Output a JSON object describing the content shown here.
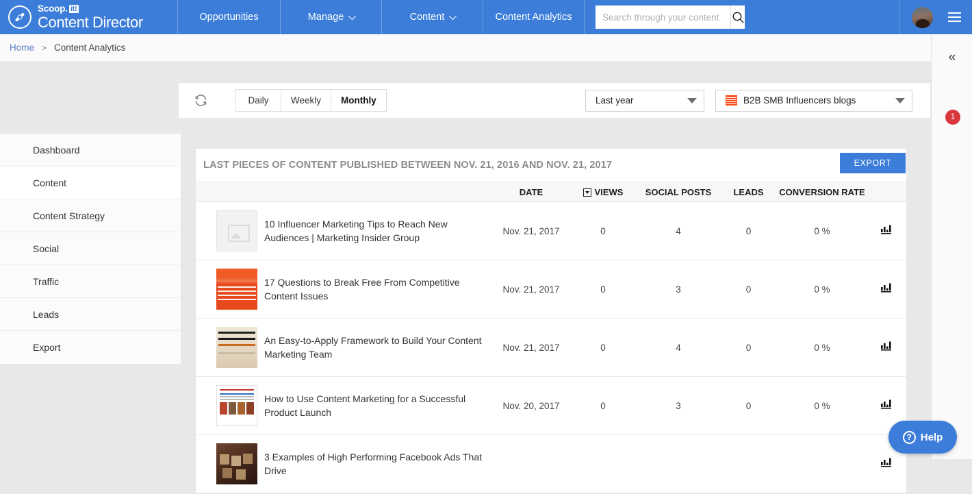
{
  "brand": {
    "top": "Scoop.",
    "badge": "it!",
    "bottom": "Content Director"
  },
  "nav": {
    "items": [
      {
        "label": "Opportunities",
        "caret": false
      },
      {
        "label": "Manage",
        "caret": true
      },
      {
        "label": "Content",
        "caret": true
      },
      {
        "label": "Content Analytics",
        "caret": false
      }
    ],
    "search": {
      "value": "",
      "placeholder": "Search through your content"
    },
    "search_icon": "search-icon",
    "avatar": "user-avatar",
    "menu_icon": "hamburger-menu-icon"
  },
  "breadcrumb": {
    "home": "Home",
    "separator": ">",
    "current": "Content Analytics"
  },
  "right_rail": {
    "collapse_icon": "«",
    "badge_count": "1"
  },
  "controls": {
    "refresh_icon": "refresh-icon",
    "periods": [
      {
        "label": "Daily",
        "active": false
      },
      {
        "label": "Weekly",
        "active": false
      },
      {
        "label": "Monthly",
        "active": true
      }
    ],
    "range_dropdown": {
      "value": "Last year"
    },
    "blog_dropdown": {
      "value": "B2B SMB Influencers blogs",
      "icon": "blog-thumbnail-icon"
    }
  },
  "sidebar": {
    "items": [
      {
        "label": "Dashboard",
        "active": false
      },
      {
        "label": "Content",
        "active": true
      },
      {
        "label": "Content Strategy",
        "active": false
      },
      {
        "label": "Social",
        "active": false
      },
      {
        "label": "Traffic",
        "active": false
      },
      {
        "label": "Leads",
        "active": false
      },
      {
        "label": "Export",
        "active": false
      }
    ]
  },
  "panel": {
    "title": "LAST PIECES OF CONTENT PUBLISHED BETWEEN NOV. 21, 2016 AND NOV. 21, 2017",
    "export_label": "EXPORT",
    "columns": {
      "thumb": "",
      "title": "",
      "date": "DATE",
      "views": "VIEWS",
      "social_posts": "SOCIAL POSTS",
      "leads": "LEADS",
      "conversion_rate": "CONVERSION RATE",
      "chart": ""
    },
    "sorted_column": "views",
    "rows": [
      {
        "thumb_style": "ph",
        "title": "10 Influencer Marketing Tips to Reach New Audiences | Marketing Insider Group",
        "date": "Nov. 21, 2017",
        "views": "0",
        "social_posts": "4",
        "leads": "0",
        "conversion_rate": "0 %",
        "chart_icon": "bar-chart-icon"
      },
      {
        "thumb_style": "t-orange",
        "title": "17 Questions to Break Free From Competitive Content Issues",
        "date": "Nov. 21, 2017",
        "views": "0",
        "social_posts": "3",
        "leads": "0",
        "conversion_rate": "0 %",
        "chart_icon": "bar-chart-icon"
      },
      {
        "thumb_style": "t-tan",
        "title": "An Easy-to-Apply Framework to Build Your Content Marketing Team",
        "date": "Nov. 21, 2017",
        "views": "0",
        "social_posts": "4",
        "leads": "0",
        "conversion_rate": "0 %",
        "chart_icon": "bar-chart-icon"
      },
      {
        "thumb_style": "t-white",
        "title": "How to Use Content Marketing for a Successful Product Launch",
        "date": "Nov. 20, 2017",
        "views": "0",
        "social_posts": "3",
        "leads": "0",
        "conversion_rate": "0 %",
        "chart_icon": "bar-chart-icon"
      },
      {
        "thumb_style": "t-dark",
        "title": "3 Examples of High Performing Facebook Ads That Drive",
        "date": "",
        "views": "",
        "social_posts": "",
        "leads": "",
        "conversion_rate": "",
        "chart_icon": "bar-chart-icon"
      }
    ]
  },
  "help": {
    "label": "Help",
    "icon": "question-circle-icon"
  },
  "colors": {
    "brand_blue": "#3b7dd8",
    "badge_red": "#d9363e",
    "page_bg": "#e8e8e8",
    "accent_orange": "#f4511e"
  }
}
